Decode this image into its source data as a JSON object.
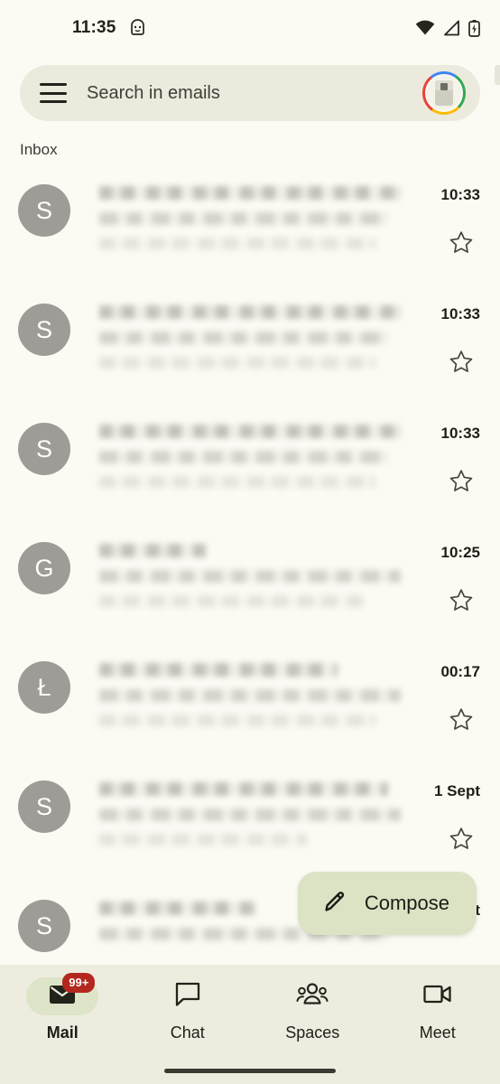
{
  "status_bar": {
    "time": "11:35",
    "icons": [
      "android-debug-icon",
      "wifi-icon",
      "signal-icon",
      "battery-charging-icon"
    ]
  },
  "search": {
    "menu_icon": "hamburger-menu-icon",
    "placeholder": "Search in emails",
    "avatar_icon": "account-avatar"
  },
  "section": {
    "label": "Inbox"
  },
  "emails": [
    {
      "avatar_letter": "S",
      "time": "10:33",
      "star": "star-outline-icon",
      "redacted": true
    },
    {
      "avatar_letter": "S",
      "time": "10:33",
      "star": "star-outline-icon",
      "redacted": true
    },
    {
      "avatar_letter": "S",
      "time": "10:33",
      "star": "star-outline-icon",
      "redacted": true
    },
    {
      "avatar_letter": "G",
      "time": "10:25",
      "star": "star-outline-icon",
      "redacted": true
    },
    {
      "avatar_letter": "Ł",
      "time": "00:17",
      "star": "star-outline-icon",
      "redacted": true
    },
    {
      "avatar_letter": "S",
      "time": "1 Sept",
      "star": "star-outline-icon",
      "redacted": true
    },
    {
      "avatar_letter": "S",
      "time": "1 Sept",
      "star": "star-outline-icon",
      "redacted": true
    }
  ],
  "compose": {
    "label": "Compose",
    "icon": "pencil-icon",
    "background": "#dbe3c4"
  },
  "bottom_nav": {
    "items": [
      {
        "label": "Mail",
        "icon": "mail-icon",
        "badge": "99+",
        "active": true
      },
      {
        "label": "Chat",
        "icon": "chat-bubble-icon",
        "badge": "",
        "active": false
      },
      {
        "label": "Spaces",
        "icon": "spaces-people-icon",
        "badge": "",
        "active": false
      },
      {
        "label": "Meet",
        "icon": "video-camera-icon",
        "badge": "",
        "active": false
      }
    ],
    "badge_color": "#b3271e",
    "active_pill_color": "#dde4c7"
  },
  "colors": {
    "page_background": "#fbfaf3",
    "search_background": "#eceadd",
    "nav_background": "#eeecdf",
    "avatar_gray": "#9d9c96",
    "text_primary": "#1d1c16"
  }
}
